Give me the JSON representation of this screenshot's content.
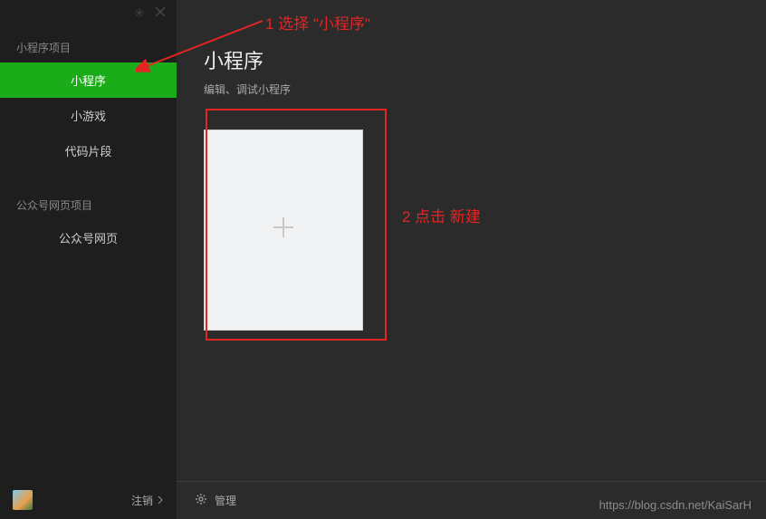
{
  "window": {
    "pin": "pin-icon",
    "close": "close-icon"
  },
  "sidebar": {
    "section1": "小程序项目",
    "items1": [
      "小程序",
      "小游戏",
      "代码片段"
    ],
    "activeIndex": 0,
    "section2": "公众号网页项目",
    "items2": [
      "公众号网页"
    ],
    "logout": "注销"
  },
  "main": {
    "title": "小程序",
    "subtitle": "编辑、调试小程序",
    "manage": "管理"
  },
  "annotations": {
    "step1": "1 选择 \"小程序\"",
    "step2": "2 点击 新建"
  },
  "watermark": "https://blog.csdn.net/KaiSarH",
  "colors": {
    "accent": "#1aad19",
    "annotation": "#e32525"
  }
}
